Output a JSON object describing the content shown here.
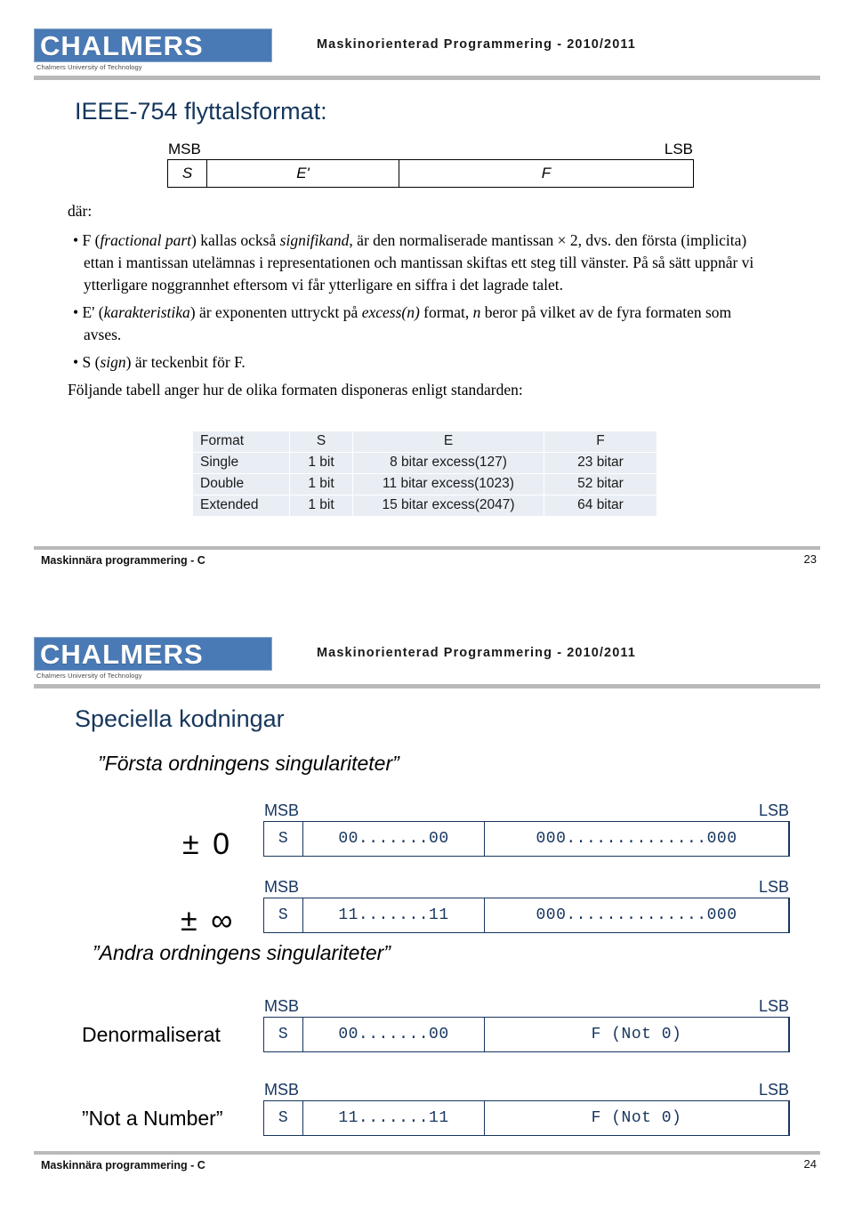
{
  "brand": {
    "logo_word": "CHALMERS",
    "logo_subtitle": "Chalmers University of Technology",
    "logo_bg": "#4a7ab5",
    "title_color": "#15365c"
  },
  "slide1": {
    "course_title": "Maskinorienterad Programmering - 2010/2011",
    "title": "IEEE-754 flyttalsformat:",
    "diagram": {
      "msb": "MSB",
      "lsb": "LSB",
      "cells": [
        "S",
        "E'",
        "F"
      ]
    },
    "body": {
      "lead": "där:",
      "bullet1": "• F (fractional part) kallas också signifikand, är den normaliserade mantissan × 2, dvs. den första (implicita) ettan i mantissan utelämnas i representationen och mantissan skiftas ett steg till vänster. På så sätt uppnår vi ytterligare noggrannhet eftersom vi får ytterligare en siffra i det lagrade talet.",
      "bullet1_parts": {
        "a": "• F (",
        "i1": "fractional part",
        "b": ") kallas också ",
        "i2": "signifikand",
        "c": ", är den normaliserade mantissan × 2, dvs. den första (implicita) ettan i mantissan utelämnas i representationen och mantissan skiftas ett steg till vänster. På så sätt uppnår vi ytterligare noggrannhet eftersom vi får ytterligare en siffra i det lagrade talet."
      },
      "bullet2_parts": {
        "a": "• E' (",
        "i1": "karakteristika",
        "b": ") är exponenten uttryckt på ",
        "i2": "excess(n)",
        "c": " format, ",
        "i3": "n",
        "d": " beror på vilket av de fyra formaten som avses."
      },
      "bullet3_parts": {
        "a": "• S (",
        "i1": "sign",
        "b": ") är teckenbit för F."
      },
      "closing": "Följande tabell anger hur de olika formaten disponeras enligt standarden:"
    },
    "table": {
      "headers": [
        "Format",
        "S",
        "E",
        "F"
      ],
      "rows": [
        [
          "Single",
          "1 bit",
          "8 bitar excess(127)",
          "23 bitar"
        ],
        [
          "Double",
          "1 bit",
          "11 bitar excess(1023)",
          "52 bitar"
        ],
        [
          "Extended",
          "1 bit",
          "15 bitar excess(2047)",
          "64 bitar"
        ]
      ]
    },
    "footer": {
      "text": "Maskinnära programmering - C",
      "page": "23"
    }
  },
  "slide2": {
    "course_title": "Maskinorienterad Programmering - 2010/2011",
    "title": "Speciella kodningar",
    "section1_heading": "”Första ordningens singulariteter”",
    "section2_heading": "”Andra ordningens singulariteter”",
    "rows": [
      {
        "label": "± 0",
        "label_style": "big",
        "msb": "MSB",
        "lsb": "LSB",
        "sign": "S",
        "exponent": "00.......00",
        "fraction": "000..............000"
      },
      {
        "label": "± ∞",
        "label_style": "big",
        "msb": "MSB",
        "lsb": "LSB",
        "sign": "S",
        "exponent": "11.......11",
        "fraction": "000..............000"
      },
      {
        "label": "Denormaliserat",
        "label_style": "normal",
        "msb": "MSB",
        "lsb": "LSB",
        "sign": "S",
        "exponent": "00.......00",
        "fraction": "F (Not 0)"
      },
      {
        "label": "”Not a Number”",
        "label_style": "normal",
        "msb": "MSB",
        "lsb": "LSB",
        "sign": "S",
        "exponent": "11.......11",
        "fraction": "F (Not 0)"
      }
    ],
    "footer": {
      "text": "Maskinnära programmering - C",
      "page": "24"
    }
  }
}
